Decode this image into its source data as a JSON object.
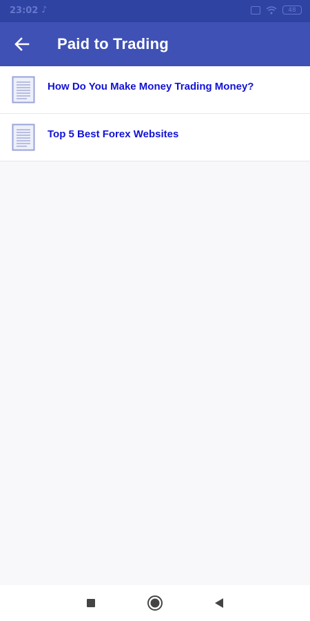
{
  "status_bar": {
    "time": "23:02",
    "battery": "48"
  },
  "app_bar": {
    "back_icon": "arrow-left-icon",
    "title": "Paid to Trading"
  },
  "articles": [
    {
      "icon": "document-icon",
      "title": "How Do You Make Money Trading Money?"
    },
    {
      "icon": "document-icon",
      "title": "Top 5 Best Forex Websites"
    }
  ],
  "colors": {
    "app_bar": "#3f51b5",
    "status_bar": "#2f43a3",
    "item_title": "#1212d6",
    "background": "#f8f8fb"
  },
  "nav_bar": {
    "recent_icon": "square-icon",
    "home_icon": "circle-icon",
    "back_icon": "triangle-back-icon"
  }
}
